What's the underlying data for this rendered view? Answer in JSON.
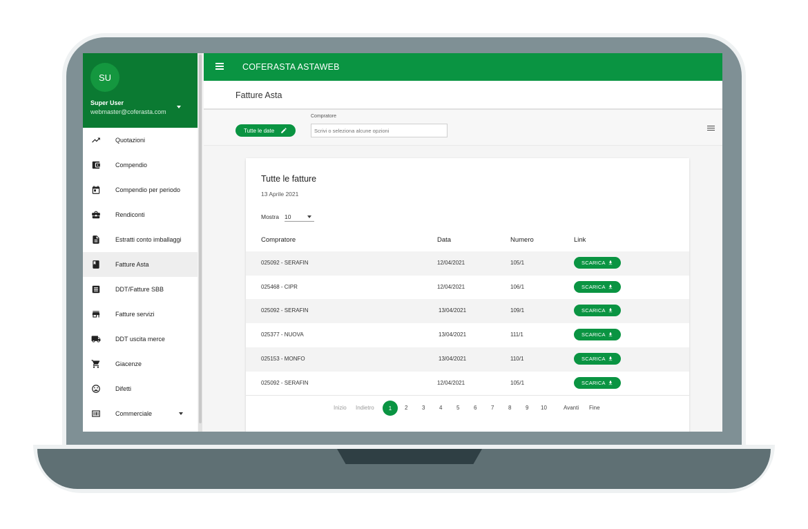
{
  "user": {
    "initials": "SU",
    "name": "Super User",
    "email": "webmaster@coferasta.com"
  },
  "sidebar": {
    "items": [
      {
        "label": "Quotazioni",
        "icon": "trending-up-icon"
      },
      {
        "label": "Compendio",
        "icon": "wallet-icon"
      },
      {
        "label": "Compendio per periodo",
        "icon": "calendar-icon"
      },
      {
        "label": "Rendiconti",
        "icon": "briefcase-icon"
      },
      {
        "label": "Estratti conto imballaggi",
        "icon": "document-icon"
      },
      {
        "label": "Fatture Asta",
        "icon": "book-icon",
        "active": true
      },
      {
        "label": "DDT/Fatture SBB",
        "icon": "receipt-icon"
      },
      {
        "label": "Fatture servizi",
        "icon": "store-icon"
      },
      {
        "label": "DDT uscita merce",
        "icon": "truck-icon"
      },
      {
        "label": "Giacenze",
        "icon": "cart-icon"
      },
      {
        "label": "Difetti",
        "icon": "sad-face-icon"
      },
      {
        "label": "Commerciale",
        "icon": "barcode-icon",
        "expandable": true
      }
    ]
  },
  "topbar": {
    "title": "COFERASTA ASTAWEB"
  },
  "page": {
    "title": "Fatture Asta"
  },
  "filters": {
    "date_chip": "Tutte le date",
    "buyer_label": "Compratore",
    "buyer_placeholder": "Scrivi o seleziona alcune opzioni"
  },
  "card": {
    "title": "Tutte le fatture",
    "date": "13 Aprile 2021",
    "show_label": "Mostra",
    "show_value": "10",
    "columns": {
      "buyer": "Compratore",
      "date": "Data",
      "number": "Numero",
      "link": "Link"
    },
    "download_label": "SCARICA",
    "rows": [
      {
        "buyer": "025092 - SERAFIN",
        "date": "12/04/2021",
        "number": "105/1"
      },
      {
        "buyer": "025468 - CIPR",
        "date": "12/04/2021",
        "number": "106/1"
      },
      {
        "buyer": "025092 - SERAFIN",
        "date": "13/04/2021",
        "number": "109/1"
      },
      {
        "buyer": "025377 - NUOVA",
        "date": "13/04/2021",
        "number": "111/1"
      },
      {
        "buyer": "025153 - MONFO",
        "date": "13/04/2021",
        "number": "110/1"
      },
      {
        "buyer": "025092 - SERAFIN",
        "date": "12/04/2021",
        "number": "105/1"
      }
    ]
  },
  "pagination": {
    "first": "Inizio",
    "prev": "Indietro",
    "pages": [
      "1",
      "2",
      "3",
      "4",
      "5",
      "6",
      "7",
      "8",
      "9",
      "10"
    ],
    "current": "1",
    "next": "Avanti",
    "last": "Fine"
  },
  "colors": {
    "primary": "#0a9442",
    "sidebar_header": "#0b7a32",
    "frame": "#7f9095"
  }
}
